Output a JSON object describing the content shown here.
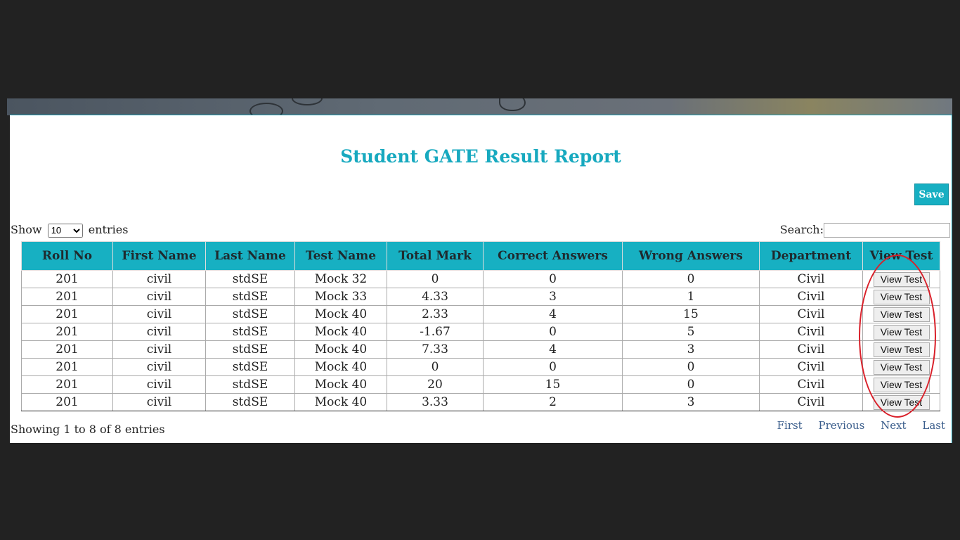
{
  "page": {
    "title": "Student GATE Result Report",
    "save_label": "Save"
  },
  "length": {
    "show_label": "Show",
    "selected": "10",
    "entries_label": "entries"
  },
  "search": {
    "label": "Search:",
    "value": ""
  },
  "table": {
    "columns": [
      "Roll No",
      "First Name",
      "Last Name",
      "Test Name",
      "Total Mark",
      "Correct Answers",
      "Wrong Answers",
      "Department",
      "View Test"
    ],
    "rows": [
      {
        "roll": "201",
        "first": "civil",
        "last": "stdSE",
        "test": "Mock 32",
        "total": "0",
        "correct": "0",
        "wrong": "0",
        "dept": "Civil",
        "action": "View Test"
      },
      {
        "roll": "201",
        "first": "civil",
        "last": "stdSE",
        "test": "Mock 33",
        "total": "4.33",
        "correct": "3",
        "wrong": "1",
        "dept": "Civil",
        "action": "View Test"
      },
      {
        "roll": "201",
        "first": "civil",
        "last": "stdSE",
        "test": "Mock 40",
        "total": "2.33",
        "correct": "4",
        "wrong": "15",
        "dept": "Civil",
        "action": "View Test"
      },
      {
        "roll": "201",
        "first": "civil",
        "last": "stdSE",
        "test": "Mock 40",
        "total": "-1.67",
        "correct": "0",
        "wrong": "5",
        "dept": "Civil",
        "action": "View Test"
      },
      {
        "roll": "201",
        "first": "civil",
        "last": "stdSE",
        "test": "Mock 40",
        "total": "7.33",
        "correct": "4",
        "wrong": "3",
        "dept": "Civil",
        "action": "View Test"
      },
      {
        "roll": "201",
        "first": "civil",
        "last": "stdSE",
        "test": "Mock 40",
        "total": "0",
        "correct": "0",
        "wrong": "0",
        "dept": "Civil",
        "action": "View Test"
      },
      {
        "roll": "201",
        "first": "civil",
        "last": "stdSE",
        "test": "Mock 40",
        "total": "20",
        "correct": "15",
        "wrong": "0",
        "dept": "Civil",
        "action": "View Test"
      },
      {
        "roll": "201",
        "first": "civil",
        "last": "stdSE",
        "test": "Mock 40",
        "total": "3.33",
        "correct": "2",
        "wrong": "3",
        "dept": "Civil",
        "action": "View Test"
      }
    ]
  },
  "footer": {
    "info": "Showing 1 to 8 of 8 entries",
    "pager": [
      "First",
      "Previous",
      "Next",
      "Last"
    ]
  },
  "colors": {
    "accent": "#17b0c2",
    "title": "#17a9bf",
    "highlight_ellipse": "#d9202a",
    "pager_link": "#3b5e8c"
  }
}
